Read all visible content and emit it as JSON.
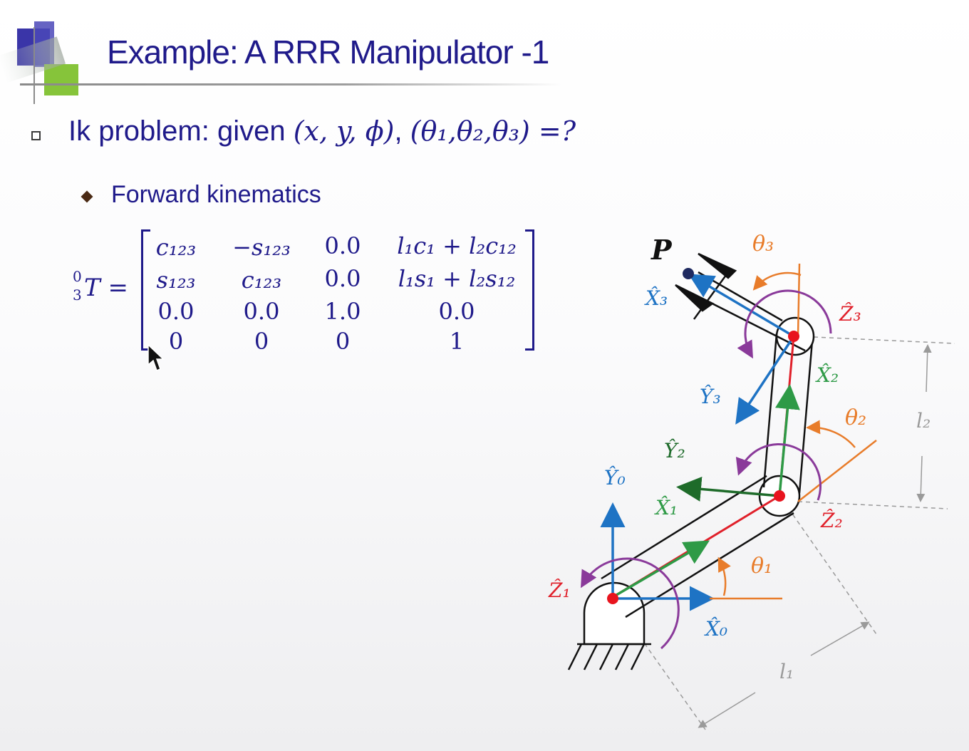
{
  "slide": {
    "title": "Example: A RRR Manipulator -1",
    "bullet_main_text": "Ik problem: given ",
    "bullet_main_math_1": "(x, y, ϕ)",
    "bullet_main_sep": ", ",
    "bullet_main_math_2": "(θ₁,θ₂,θ₃) =?",
    "sub_bullet": "Forward kinematics"
  },
  "matrix": {
    "lhs_sup": "0",
    "lhs_sub": "3",
    "lhs": "T =",
    "rows": [
      [
        "c₁₂₃",
        "−s₁₂₃",
        "0.0",
        "l₁c₁ + l₂c₁₂"
      ],
      [
        "s₁₂₃",
        "c₁₂₃",
        "0.0",
        "l₁s₁ + l₂s₁₂"
      ],
      [
        "0.0",
        "0.0",
        "1.0",
        "0.0"
      ],
      [
        "0",
        "0",
        "0",
        "1"
      ]
    ]
  },
  "diagram": {
    "labels": {
      "P": "P",
      "theta1": "θ₁",
      "theta2": "θ₂",
      "theta3": "θ₃",
      "X0": "X̂₀",
      "Y0": "Ŷ₀",
      "Z1": "Ẑ₁",
      "X1": "X̂₁",
      "Y2": "Ŷ₂",
      "X2": "X̂₂",
      "Z2": "Ẑ₂",
      "X3": "X̂₃",
      "Y3": "Ŷ₃",
      "Z3": "Ẑ₃",
      "l1": "l₁",
      "l2": "l₂"
    },
    "colors": {
      "text": "#1f1a8a",
      "blue_axis": "#1e73c4",
      "green_axis": "#2e9a46",
      "dark_green_axis": "#1e6b2a",
      "link_red": "#e0202a",
      "angle_orange": "#e87c2a",
      "rotation_purple": "#8a3a9a",
      "dimension_gray": "#9a9a9a"
    }
  }
}
